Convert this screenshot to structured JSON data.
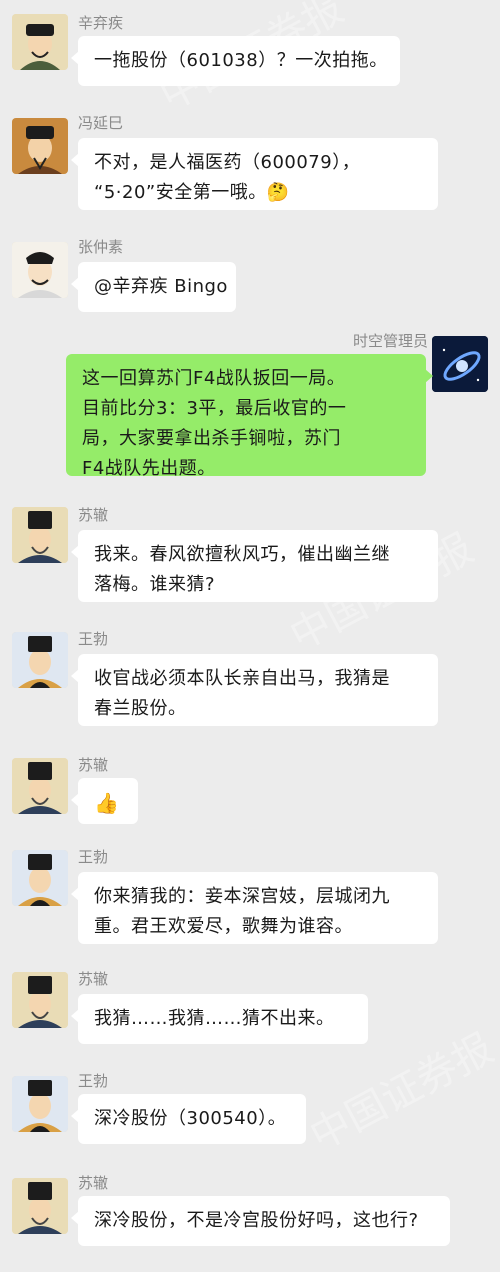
{
  "watermark": "中国证券报",
  "messages": [
    {
      "sender": "辛弃疾",
      "lines": [
        "一拖股份（601038）？一次拍拖。"
      ]
    },
    {
      "sender": "冯延巳",
      "lines": [
        "不对，是人福医药（600079），",
        "“5·20”安全第一哦。🤔"
      ]
    },
    {
      "sender": "张仲素",
      "lines": [
        "@辛弃疾 Bingo"
      ]
    },
    {
      "sender": "时空管理员",
      "lines": [
        "这一回算苏门F4战队扳回一局。",
        "目前比分3：3平，最后收官的一",
        "局，大家要拿出杀手锏啦，苏门",
        "F4战队先出题。"
      ]
    },
    {
      "sender": "苏辙",
      "lines": [
        "我来。春风欲擅秋风巧，催出幽兰继",
        "落梅。谁来猜?"
      ]
    },
    {
      "sender": "王勃",
      "lines": [
        "收官战必须本队长亲自出马，我猜是",
        "春兰股份。"
      ]
    },
    {
      "sender": "苏辙",
      "lines": [
        "👍"
      ]
    },
    {
      "sender": "王勃",
      "lines": [
        "你来猜我的：妾本深宫妓，层城闭九",
        "重。君王欢爱尽，歌舞为谁容。"
      ]
    },
    {
      "sender": "苏辙",
      "lines": [
        "我猜……我猜……猜不出来。"
      ]
    },
    {
      "sender": "王勃",
      "lines": [
        "深冷股份（300540）。"
      ]
    },
    {
      "sender": "苏辙",
      "lines": [
        "深冷股份，不是冷宫股份好吗，这也行?"
      ]
    }
  ]
}
